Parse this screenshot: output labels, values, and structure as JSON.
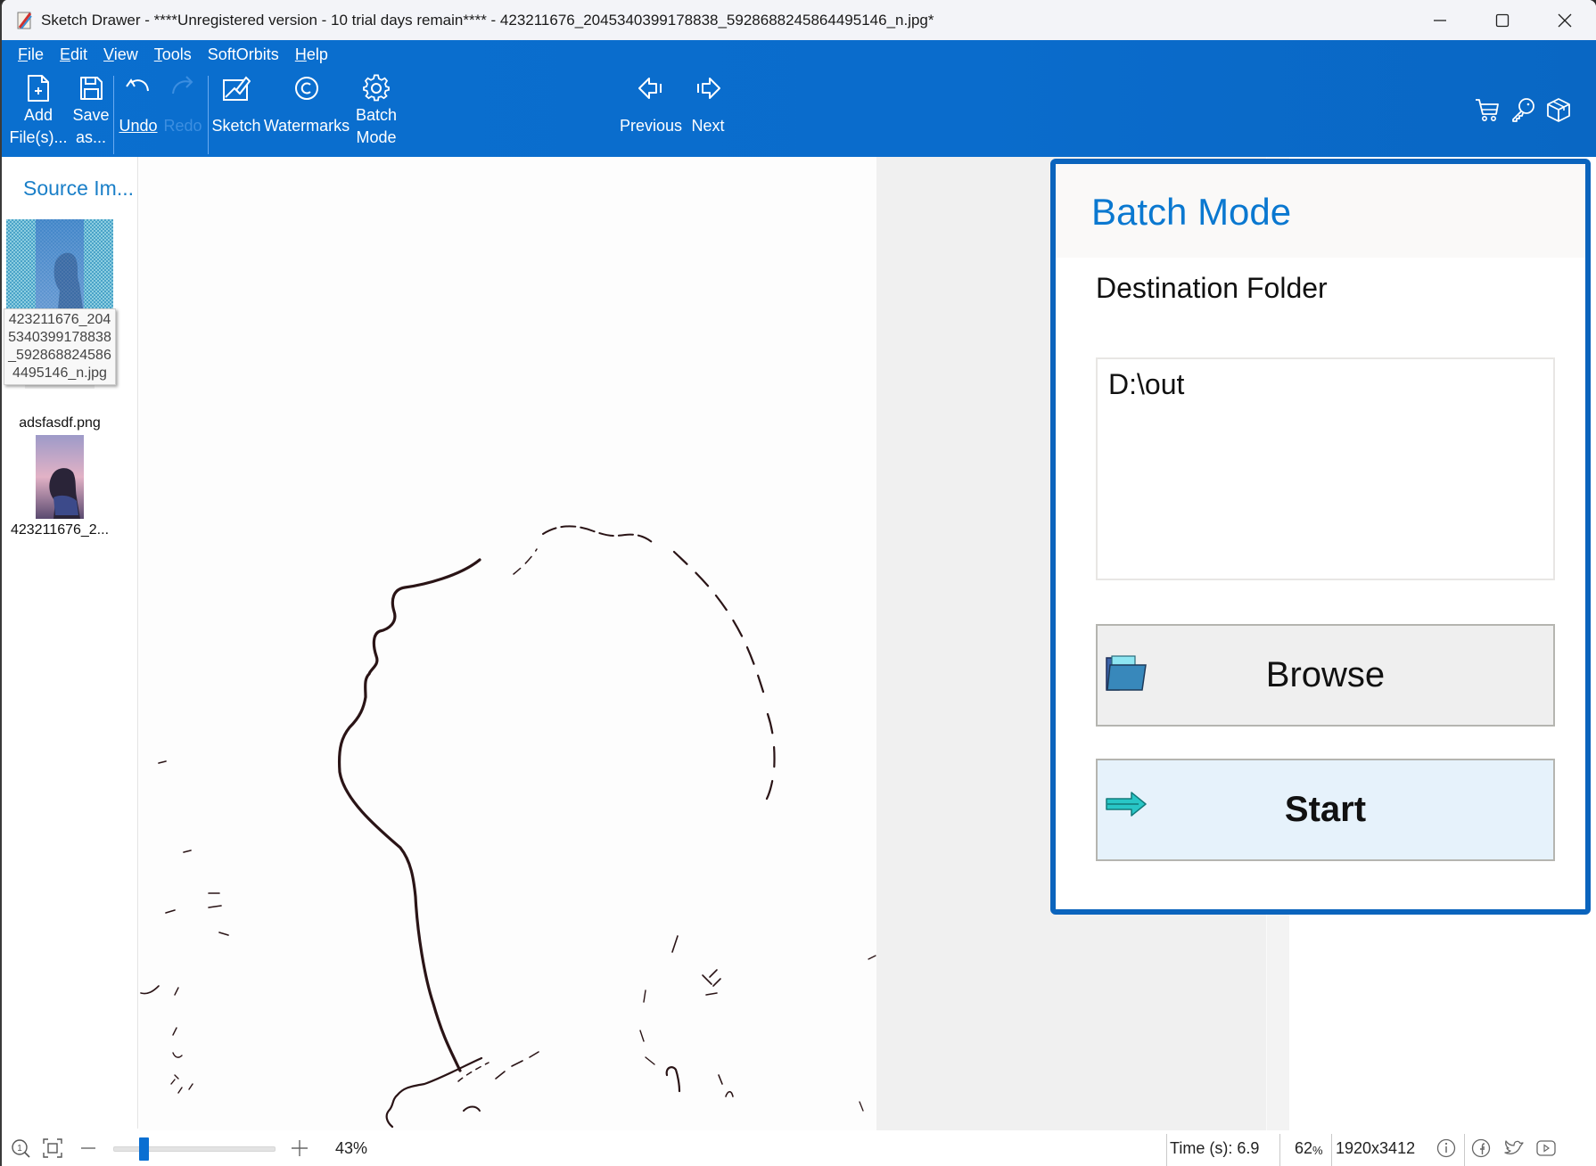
{
  "window": {
    "title": "Sketch Drawer - ****Unregistered version - 10 trial days remain**** - 423211676_2045340399178838_5928688245864495146_n.jpg*",
    "controls": [
      "minimize",
      "maximize",
      "close"
    ]
  },
  "menu": [
    {
      "label": "File",
      "accel": "F",
      "rest": "ile"
    },
    {
      "label": "Edit",
      "accel": "E",
      "rest": "dit"
    },
    {
      "label": "View",
      "accel": "V",
      "rest": "iew"
    },
    {
      "label": "Tools",
      "accel": "T",
      "rest": "ools"
    },
    {
      "label": "SoftOrbits",
      "accel": "",
      "rest": "SoftOrbits"
    },
    {
      "label": "Help",
      "accel": "H",
      "rest": "elp"
    }
  ],
  "toolbar": {
    "add_files_line1": "Add",
    "add_files_line2": "File(s)...",
    "save_as_line1": "Save",
    "save_as_line2": "as...",
    "undo": "Undo",
    "redo": "Redo",
    "sketch": "Sketch",
    "watermarks": "Watermarks",
    "batch_line1": "Batch",
    "batch_line2": "Mode",
    "previous": "Previous",
    "next": "Next",
    "right_icons": [
      "cart-icon",
      "key-icon",
      "box-icon"
    ]
  },
  "sidebar": {
    "title": "Source Im...",
    "items": [
      {
        "name": "423211676_2045340399178838_5928688245864495146_n.jpg",
        "selected": true
      },
      {
        "name": "adsfasdf.png",
        "selected": false
      },
      {
        "name": "423211676_2...",
        "selected": false
      }
    ],
    "tooltip_lines": [
      "423211676_204",
      "5340399178838",
      "_592868824586",
      "4495146_n.jpg"
    ]
  },
  "batch_panel": {
    "title": "Batch Mode",
    "destination_label": "Destination Folder",
    "destination_value": "D:\\out",
    "browse_label": "Browse",
    "start_label": "Start"
  },
  "statusbar": {
    "zoom_percent": "43%",
    "zoom_slider_value": 0.17,
    "time_label": "Time (s): 6.9",
    "quality": "62",
    "quality_unit": "%",
    "dimensions": "1920x3412",
    "icons": [
      "info-icon",
      "facebook-icon",
      "twitter-icon",
      "youtube-icon"
    ]
  },
  "colors": {
    "accent": "#0a6fcf",
    "panel_border": "#0b64bd",
    "panel_title": "#0a78d0",
    "sidebar_title": "#1a7fc8",
    "start_bg": "#e6f2fb",
    "browse_bg": "#efefef"
  }
}
